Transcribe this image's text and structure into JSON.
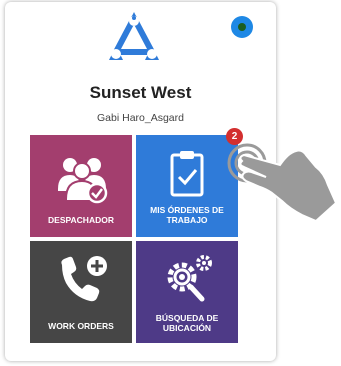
{
  "app": {
    "company_name": "Sunset West",
    "user_name": "Gabi Haro_Asgard",
    "logo_icon": "triangle-nodes-logo-icon",
    "accent_color": "#2f7bd9"
  },
  "status": {
    "icon": "status-dot-icon",
    "color": "#1e88e5"
  },
  "tiles": [
    {
      "label": "DESPACHADOR",
      "icon": "group-check-icon",
      "color": "#a33e6e"
    },
    {
      "label_line1": "MIS ÓRDENES DE",
      "label_line2": "TRABAJO",
      "icon": "clipboard-check-icon",
      "color": "#2f7bd9",
      "badge": "2"
    },
    {
      "label": "WORK ORDERS",
      "icon": "phone-plus-icon",
      "color": "#464646"
    },
    {
      "label_line1": "BÚSQUEDA DE",
      "label_line2": "UBICACIÓN",
      "icon": "gears-search-icon",
      "color": "#4e3a87"
    }
  ],
  "overlay": {
    "icon": "tap-hand-icon"
  }
}
